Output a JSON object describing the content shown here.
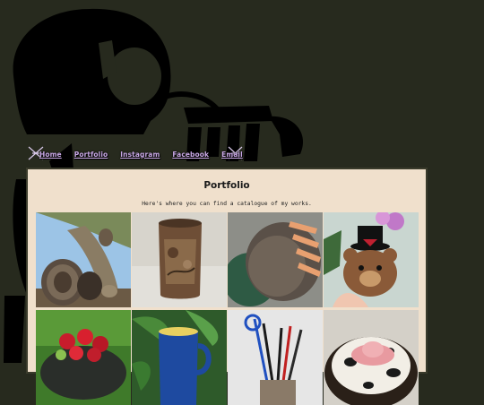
{
  "nav": {
    "items": [
      {
        "label": "Home"
      },
      {
        "label": "Portfolio"
      },
      {
        "label": "Instagram"
      },
      {
        "label": "Facebook"
      },
      {
        "label": "Email"
      }
    ]
  },
  "main": {
    "title": "Portfolio",
    "subtitle": "Here's where you can find a catalogue of my works."
  },
  "colors": {
    "background": "#272a1e",
    "panel": "#f0e0cc",
    "nav_link": "#c9a8e6"
  }
}
